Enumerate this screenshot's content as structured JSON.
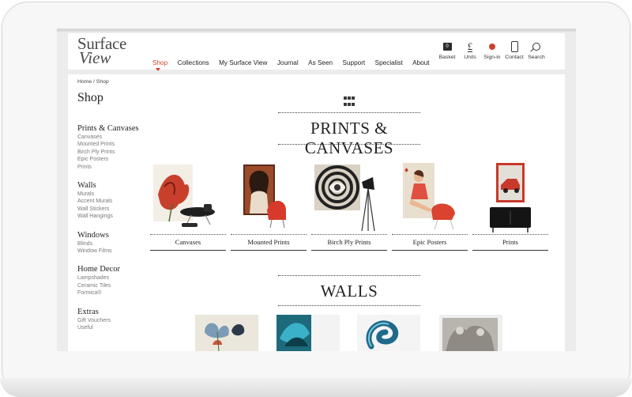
{
  "brand": {
    "logo_line1": "Surface",
    "logo_line2": "View"
  },
  "nav": {
    "items": [
      "Shop",
      "Collections",
      "My Surface View",
      "Journal",
      "As Seen",
      "Support",
      "Specialist",
      "About"
    ],
    "active": "Shop"
  },
  "utilities": {
    "basket": "Basket",
    "basket_count": "0",
    "units": "Units",
    "units_symbol": "£",
    "signin": "Sign-in",
    "contact": "Contact",
    "search": "Search"
  },
  "breadcrumb": "Home / Shop",
  "page_title": "Shop",
  "sidebar": [
    {
      "heading": "Prints & Canvases",
      "items": [
        "Canvases",
        "Mounted Prints",
        "Birch Ply Prints",
        "Epic Posters",
        "Prints"
      ]
    },
    {
      "heading": "Walls",
      "items": [
        "Murals",
        "Accent Murals",
        "Wall Stickers",
        "Wall Hangings"
      ]
    },
    {
      "heading": "Windows",
      "items": [
        "Blinds",
        "Window Films"
      ]
    },
    {
      "heading": "Home Decor",
      "items": [
        "Lampshades",
        "Ceramic Tiles",
        "Formica®"
      ]
    },
    {
      "heading": "Extras",
      "items": [
        "Gift Vouchers",
        "Useful"
      ]
    }
  ],
  "sections": {
    "prints_title": "PRINTS & CANVASES",
    "walls_title": "WALLS"
  },
  "categories": [
    "Canvases",
    "Mounted Prints",
    "Birch Ply Prints",
    "Epic Posters",
    "Prints"
  ],
  "colors": {
    "accent": "#d0452f",
    "text": "#222222",
    "muted": "#7a7a7a"
  }
}
